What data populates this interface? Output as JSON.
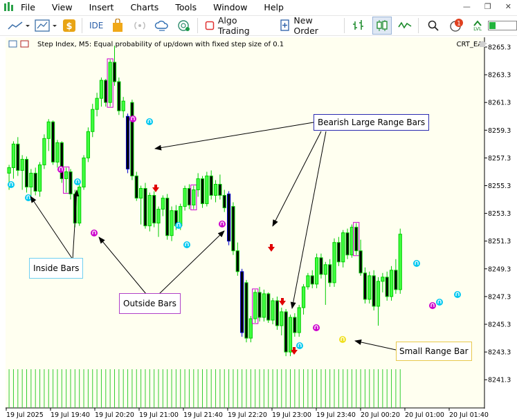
{
  "menu": {
    "items": [
      "File",
      "View",
      "Insert",
      "Charts",
      "Tools",
      "Window",
      "Help"
    ]
  },
  "window_controls": {
    "minimize": "—",
    "restore": "❐",
    "close": "✕"
  },
  "toolbar": {
    "ide_label": "IDE",
    "algo_trading_label": "Algo Trading",
    "new_order_label": "New Order",
    "notification_count": "1",
    "lvl_label": "LVL"
  },
  "chart": {
    "title": "Step Index, M5:  Equal probability of up/down with fixed step size of 0.1",
    "ea_name": "CRT_EA",
    "price_labels": [
      "8265.3",
      "8263.3",
      "8261.3",
      "8259.3",
      "8257.3",
      "8255.3",
      "8253.3",
      "8251.3",
      "8249.3",
      "8247.3",
      "8245.3",
      "8243.3",
      "8241.3"
    ],
    "time_labels": [
      "19 Jul 2025",
      "19 Jul 19:40",
      "19 Jul 20:20",
      "19 Jul 21:00",
      "19 Jul 21:40",
      "19 Jul 22:20",
      "19 Jul 23:00",
      "19 Jul 23:40",
      "20 Jul 00:20",
      "20 Jul 01:00",
      "20 Jul 01:40"
    ],
    "colors": {
      "background": "#fffff0",
      "bull": "#00cc00",
      "volume": "#32cd32",
      "bearish_large": "#0000cd",
      "outside": "#cc00cc",
      "inside_arrow": "#00c8f0",
      "small_arrow": "#f0e020",
      "sell_arrow": "#e00000"
    }
  },
  "annotations": {
    "bearish": "Bearish Large Range Bars",
    "inside": "Inside Bars",
    "outside": "Outside Bars",
    "small": "Small Range Bar"
  }
}
